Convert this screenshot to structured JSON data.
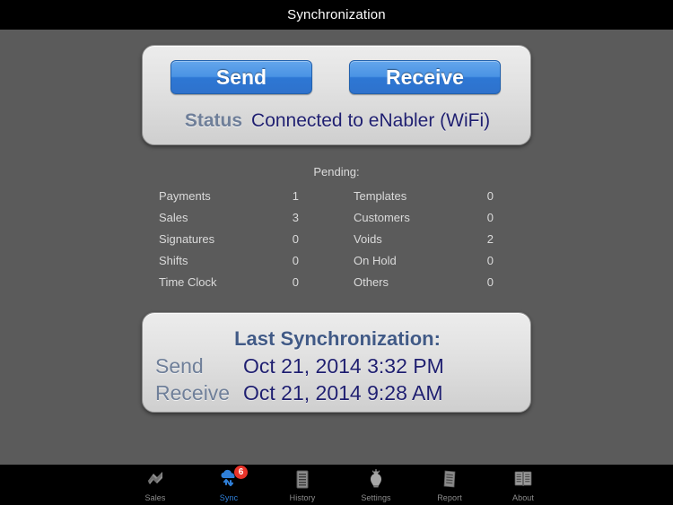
{
  "titlebar": {
    "title": "Synchronization"
  },
  "sync_panel": {
    "send_button": "Send",
    "receive_button": "Receive",
    "status_label": "Status",
    "status_value": "Connected to eNabler (WiFi)"
  },
  "pending": {
    "title": "Pending:",
    "left_column": [
      {
        "label": "Payments",
        "value": "1"
      },
      {
        "label": "Sales",
        "value": "3"
      },
      {
        "label": "Signatures",
        "value": "0"
      },
      {
        "label": "Shifts",
        "value": "0"
      },
      {
        "label": "Time Clock",
        "value": "0"
      }
    ],
    "right_column": [
      {
        "label": "Templates",
        "value": "0"
      },
      {
        "label": "Customers",
        "value": "0"
      },
      {
        "label": "Voids",
        "value": "2"
      },
      {
        "label": "On Hold",
        "value": "0"
      },
      {
        "label": "Others",
        "value": "0"
      }
    ]
  },
  "last_sync": {
    "title": "Last Synchronization:",
    "send_label": "Send",
    "send_value": "Oct 21, 2014 3:32 PM",
    "receive_label": "Receive",
    "receive_value": "Oct 21, 2014 9:28 AM"
  },
  "tabbar": {
    "tabs": [
      {
        "label": "Sales",
        "icon": "sales-icon",
        "active": false,
        "badge": ""
      },
      {
        "label": "Sync",
        "icon": "sync-cloud-icon",
        "active": true,
        "badge": "6"
      },
      {
        "label": "History",
        "icon": "history-icon",
        "active": false,
        "badge": ""
      },
      {
        "label": "Settings",
        "icon": "bulb-icon",
        "active": false,
        "badge": ""
      },
      {
        "label": "Report",
        "icon": "report-icon",
        "active": false,
        "badge": ""
      },
      {
        "label": "About",
        "icon": "book-icon",
        "active": false,
        "badge": ""
      }
    ]
  },
  "colors": {
    "background": "#5b5b5b",
    "bar": "#000000",
    "button_blue": "#4a93e4",
    "value_navy": "#1f1f70",
    "label_slate": "#6f7f99",
    "badge_red": "#e8342a",
    "active_tab": "#2f7fd8"
  }
}
